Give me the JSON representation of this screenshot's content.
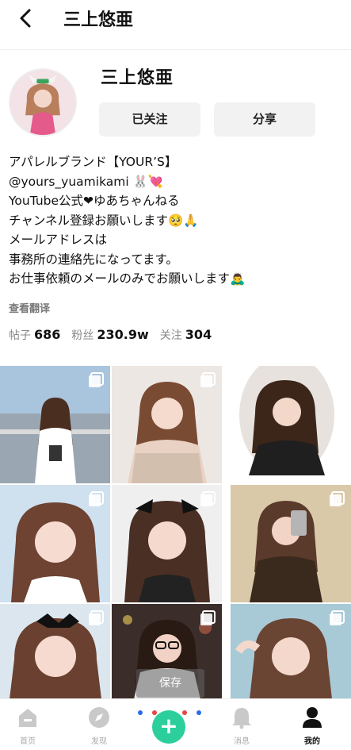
{
  "header": {
    "title": "三上悠亜"
  },
  "profile": {
    "name": "三上悠亜",
    "follow_label": "已关注",
    "share_label": "分享",
    "bio_lines": [
      "アパレルブランド【YOUR’S】",
      "@yours_yuamikami 🐰💘",
      "YouTube公式❤ゆあちゃんねる",
      "チャンネル登録お願いします🥺🙏",
      "メールアドレスは",
      "事務所の連絡先になってます。",
      "お仕事依頼のメールのみでお願いします🙇‍♂️"
    ],
    "translate_label": "查看翻译"
  },
  "stats": {
    "posts_label": "帖子",
    "posts_value": "686",
    "fans_label": "粉丝",
    "fans_value": "230.9w",
    "following_label": "关注",
    "following_value": "304"
  },
  "grid": {
    "save_label": "保存"
  },
  "nav": {
    "home": "首页",
    "discover": "发现",
    "messages": "消息",
    "me": "我的"
  },
  "colors": {
    "accent": "#2ccf9b",
    "dot_colors": [
      "#2b6be8",
      "#e84545",
      "#2ccf9b",
      "#2b6be8",
      "#e84545"
    ]
  }
}
